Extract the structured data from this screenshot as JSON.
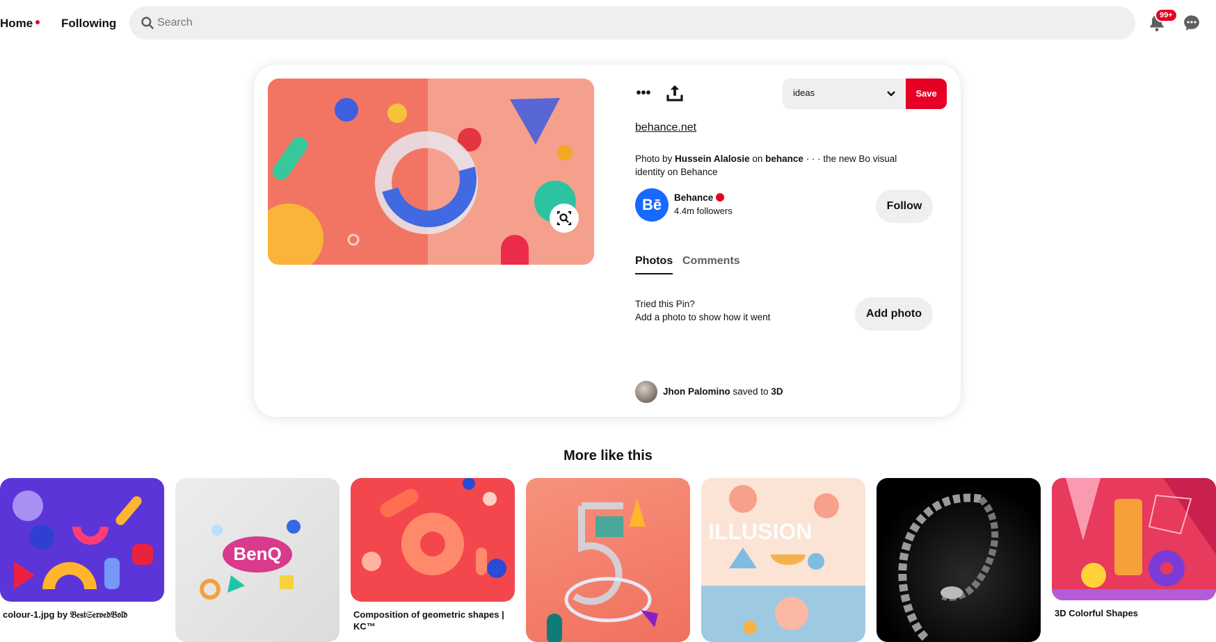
{
  "nav": {
    "home": "Home",
    "following": "Following"
  },
  "search": {
    "placeholder": "Search"
  },
  "notifications": {
    "badge": "99+"
  },
  "pin": {
    "board": "ideas",
    "save": "Save",
    "source": "behance.net",
    "desc_prefix": "Photo by ",
    "desc_author": "Hussein Alalosie",
    "desc_on": " on ",
    "desc_site": "behance",
    "desc_suffix": " · · · the new Bo visual identity on Behance",
    "profile": {
      "initials": "Bē",
      "name": "Behance",
      "followers": "4.4m followers"
    },
    "follow": "Follow",
    "tabs": [
      "Photos",
      "Comments"
    ],
    "tried_line1": "Tried this Pin?",
    "tried_line2": "Add a photo to show how it went",
    "add_photo": "Add photo",
    "saved_by_user": "Jhon Palomino",
    "saved_to_text": " saved to ",
    "saved_board": "3D"
  },
  "more": {
    "title": "More like this",
    "items": [
      {
        "caption": "colour-1.jpg by 𝔅𝔢𝔰𝔱𝔖𝔢𝔯𝔳𝔢𝔡𝔅𝔬𝔩𝔡"
      },
      {
        "caption": ""
      },
      {
        "caption": "Composition of geometric shapes | KC™"
      },
      {
        "caption": ""
      },
      {
        "caption": ""
      },
      {
        "caption": ""
      },
      {
        "caption": "3D Colorful Shapes"
      }
    ]
  },
  "colors": {
    "brand_red": "#e60023",
    "behance_blue": "#1769ff",
    "panel_grey": "#efefef"
  }
}
